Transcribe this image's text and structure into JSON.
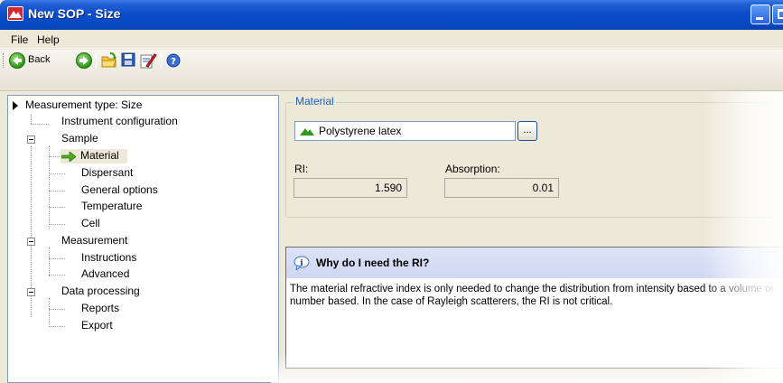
{
  "window": {
    "title": "New SOP - Size",
    "accent": "#0848c2"
  },
  "menu": {
    "file": "File",
    "help": "Help"
  },
  "toolbar": {
    "back_label": "Back",
    "icons": [
      "back-icon",
      "forward-icon",
      "open-folder-icon",
      "save-icon",
      "edit-icon",
      "help-icon"
    ]
  },
  "tree": {
    "root": "Measurement type: Size",
    "items": [
      "Instrument configuration",
      "Sample",
      "Material",
      "Dispersant",
      "General options",
      "Temperature",
      "Cell",
      "Measurement",
      "Instructions",
      "Advanced",
      "Data processing",
      "Reports",
      "Export"
    ],
    "selected": "Material"
  },
  "material": {
    "group_label": "Material",
    "value": "Polystyrene latex",
    "browse_label": "...",
    "ri_label": "RI:",
    "ri_value": "1.590",
    "absorption_label": "Absorption:",
    "absorption_value": "0.01"
  },
  "help": {
    "title": "Why do I need the RI?",
    "body": "The material refractive index is only needed to change the distribution from intensity based to a volume or number based.  In the case of Rayleigh scatterers, the RI is not critical."
  }
}
